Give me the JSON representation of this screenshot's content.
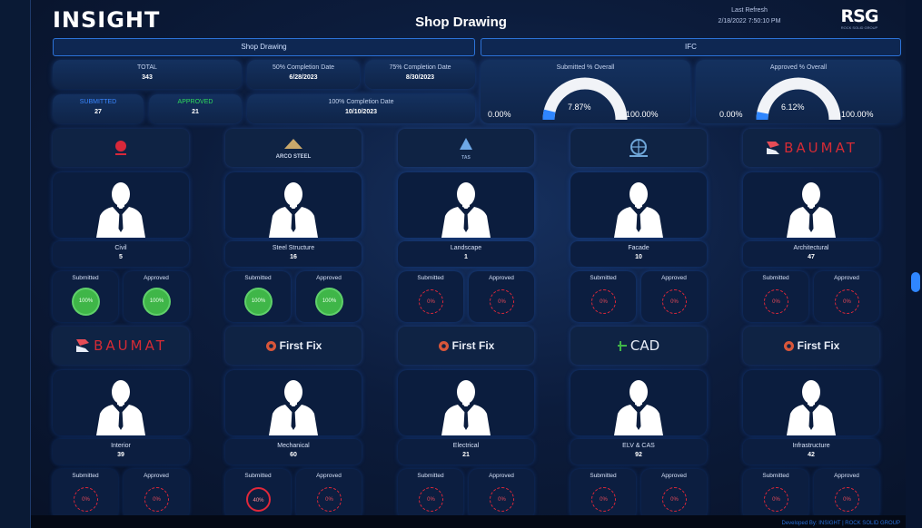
{
  "header": {
    "logo": "INSIGHT",
    "title": "Shop Drawing",
    "refresh_label": "Last Refresh",
    "refresh_time": "2/18/2022 7:50:10 PM",
    "brand_big": "RSG",
    "brand_small": "ROCK SOLID GROUP"
  },
  "tabs": {
    "left": "Shop Drawing",
    "right": "IFC"
  },
  "kpis": {
    "total_label": "TOTAL",
    "total_value": "343",
    "c50_label": "50% Completion Date",
    "c50_value": "6/28/2023",
    "c75_label": "75% Completion Date",
    "c75_value": "8/30/2023",
    "c100_label": "100% Completion Date",
    "c100_value": "10/10/2023",
    "submitted_label": "SUBMITTED",
    "submitted_value": "27",
    "approved_label": "APPROVED",
    "approved_value": "21"
  },
  "gauges": {
    "submitted": {
      "label": "Submitted % Overall",
      "min": "0.00%",
      "max": "100.00%",
      "value_text": "7.87%",
      "fraction": 0.0787
    },
    "approved": {
      "label": "Approved % Overall",
      "min": "0.00%",
      "max": "100.00%",
      "value_text": "6.12%",
      "fraction": 0.0612
    }
  },
  "colors": {
    "accent": "#2c73d8",
    "green": "#3fb648",
    "red": "#e0283a"
  },
  "contractors": [
    {
      "logo_type": "emblem-red",
      "logo_text": "",
      "name": "Civil",
      "count": "5",
      "submitted_label": "Submitted",
      "approved_label": "Approved",
      "submitted_pct": "100%",
      "approved_pct": "100%",
      "status": "green"
    },
    {
      "logo_type": "arcosteel",
      "logo_text": "ARCO STEEL",
      "name": "Steel Structure",
      "count": "16",
      "submitted_label": "Submitted",
      "approved_label": "Approved",
      "submitted_pct": "100%",
      "approved_pct": "100%",
      "status": "green"
    },
    {
      "logo_type": "emblem-blue",
      "logo_text": "TAS",
      "name": "Landscape",
      "count": "1",
      "submitted_label": "Submitted",
      "approved_label": "Approved",
      "submitted_pct": "0%",
      "approved_pct": "0%",
      "status": "red"
    },
    {
      "logo_type": "emblem-globe",
      "logo_text": "",
      "name": "Facade",
      "count": "10",
      "submitted_label": "Submitted",
      "approved_label": "Approved",
      "submitted_pct": "0%",
      "approved_pct": "0%",
      "status": "red"
    },
    {
      "logo_type": "baumat",
      "logo_text": "BAUMAT",
      "name": "Architectural",
      "count": "47",
      "submitted_label": "Submitted",
      "approved_label": "Approved",
      "submitted_pct": "0%",
      "approved_pct": "0%",
      "status": "red"
    },
    {
      "logo_type": "baumat",
      "logo_text": "BAUMAT",
      "name": "Interior",
      "count": "39",
      "submitted_label": "Submitted",
      "approved_label": "Approved",
      "submitted_pct": "0%",
      "approved_pct": "0%",
      "status": "red"
    },
    {
      "logo_type": "firstfix",
      "logo_text": "First Fix",
      "name": "Mechanical",
      "count": "60",
      "submitted_label": "Submitted",
      "approved_label": "Approved",
      "submitted_pct": "40%",
      "approved_pct": "0%",
      "status": "red"
    },
    {
      "logo_type": "firstfix",
      "logo_text": "First Fix",
      "name": "Electrical",
      "count": "21",
      "submitted_label": "Submitted",
      "approved_label": "Approved",
      "submitted_pct": "0%",
      "approved_pct": "0%",
      "status": "red"
    },
    {
      "logo_type": "cad",
      "logo_text": "CAD",
      "name": "ELV & CAS",
      "count": "92",
      "submitted_label": "Submitted",
      "approved_label": "Approved",
      "submitted_pct": "0%",
      "approved_pct": "0%",
      "status": "red"
    },
    {
      "logo_type": "firstfix",
      "logo_text": "First Fix",
      "name": "Infrastructure",
      "count": "42",
      "submitted_label": "Submitted",
      "approved_label": "Approved",
      "submitted_pct": "0%",
      "approved_pct": "0%",
      "status": "red"
    }
  ],
  "footer": {
    "credit": "Developed By: INSIGHT | ROCK SOLID GROUP"
  }
}
